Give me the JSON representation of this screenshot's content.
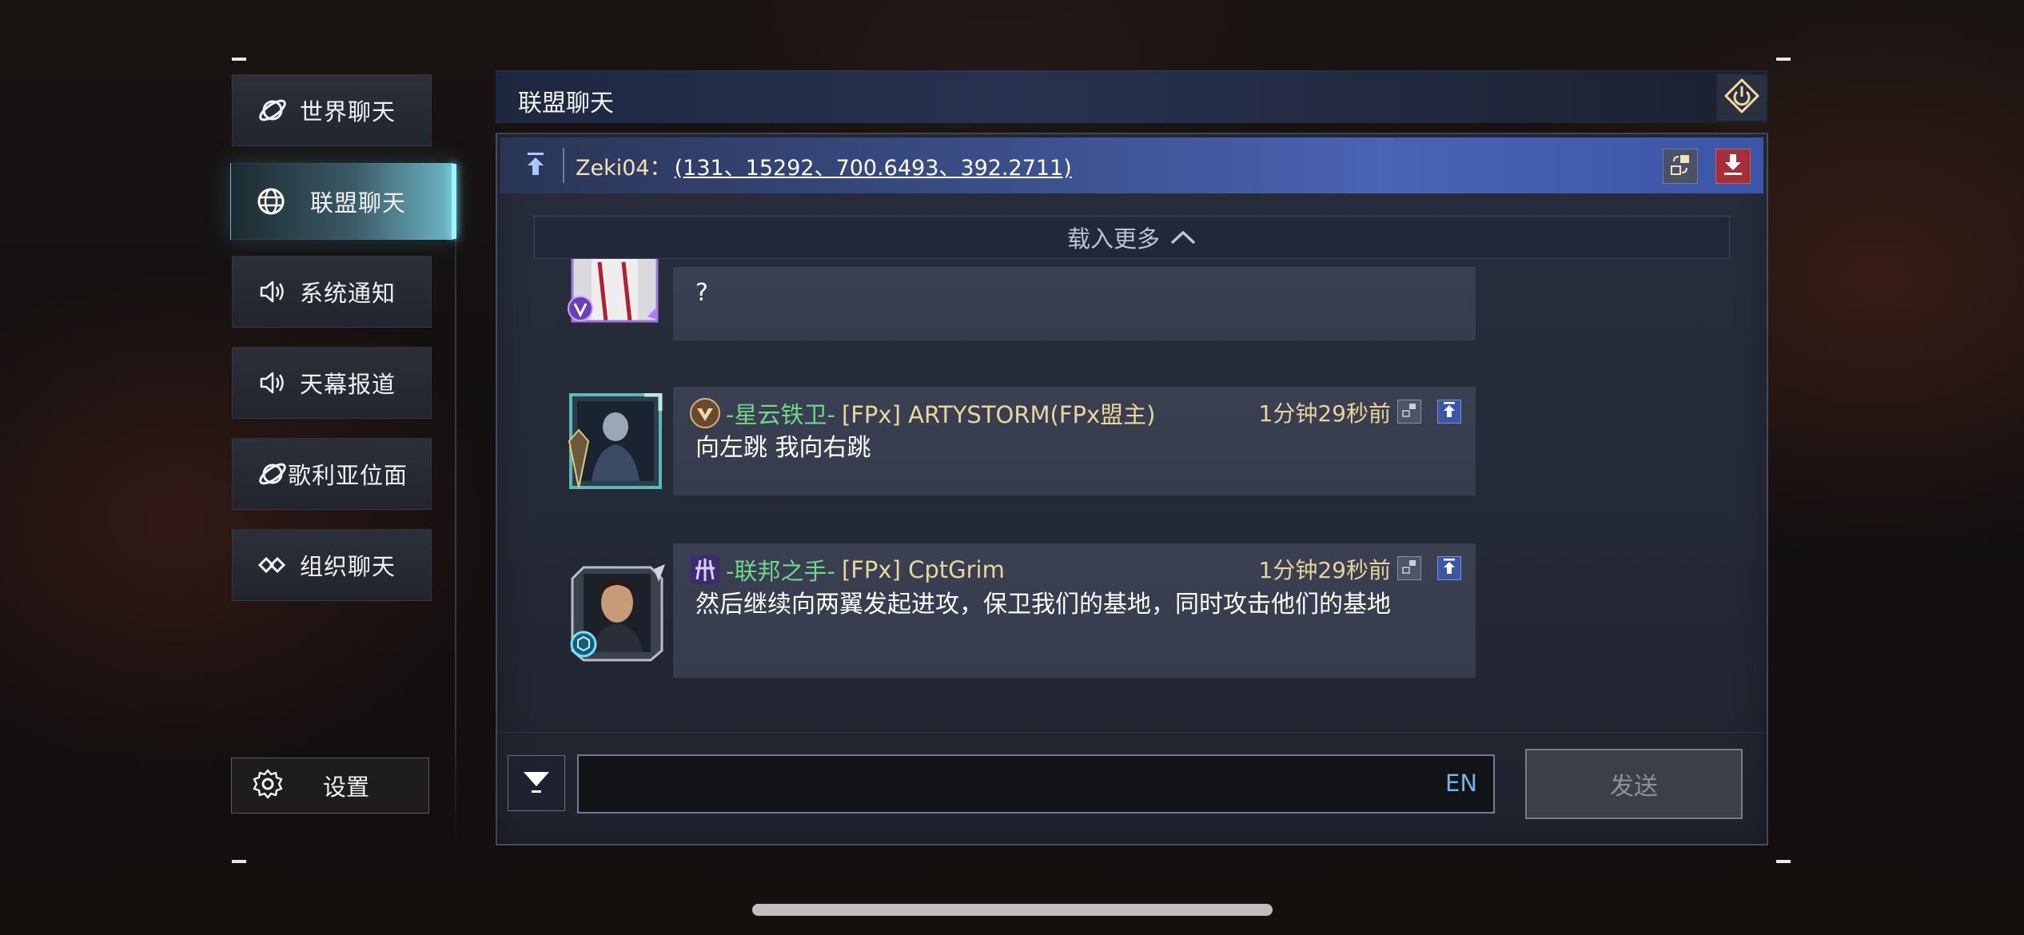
{
  "sidebar": {
    "items": [
      {
        "label": "世界聊天",
        "icon": "planet-icon",
        "active": false
      },
      {
        "label": "联盟聊天",
        "icon": "globe-icon",
        "active": true
      },
      {
        "label": "系统通知",
        "icon": "speaker-icon",
        "active": false
      },
      {
        "label": "天幕报道",
        "icon": "speaker-icon",
        "active": false
      },
      {
        "label": "歌利亚位面",
        "icon": "planet-icon",
        "active": false
      },
      {
        "label": "组织聊天",
        "icon": "organization-icon",
        "active": false
      }
    ],
    "settings_label": "设置"
  },
  "panel": {
    "title": "联盟聊天"
  },
  "pinned": {
    "author": "Zeki04：",
    "coordinates": "(131、15292、700.6493、392.2711)"
  },
  "load_more_label": "载入更多",
  "messages": [
    {
      "partial": true,
      "text": "?"
    },
    {
      "title": "-星云铁卫-",
      "name": "[FPx] ARTYSTORM(FPx盟主)",
      "time": "1分钟29秒前",
      "text": "向左跳 我向右跳"
    },
    {
      "title": "-联邦之手-",
      "name": "[FPx] CptGrim",
      "time": "1分钟29秒前",
      "text": "然后继续向两翼发起进攻，保卫我们的基地，同时攻击他们的基地"
    }
  ],
  "input": {
    "value": "",
    "lang_label": "EN"
  },
  "send_label": "发送",
  "colors": {
    "accent_cyan": "#7fe9ff",
    "pinned_blue": "#4a63b4",
    "title_green": "#6fd68a",
    "name_gold": "#e7d79a",
    "lang_blue": "#6fb3e8"
  }
}
